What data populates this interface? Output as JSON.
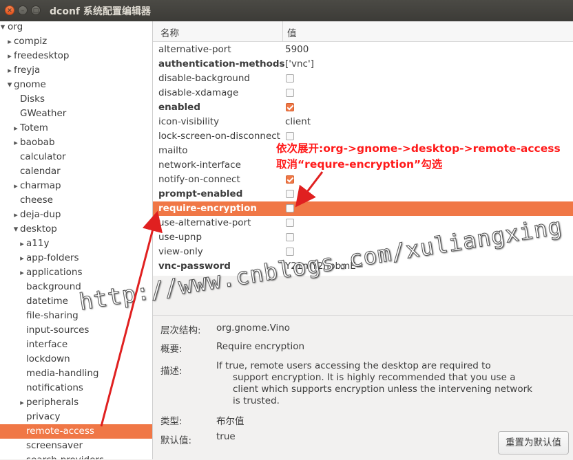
{
  "window": {
    "title": "dconf 系统配置编辑器"
  },
  "tree": [
    {
      "label": "org",
      "level": 0,
      "arrow": "down"
    },
    {
      "label": "compiz",
      "level": 1,
      "arrow": "right"
    },
    {
      "label": "freedesktop",
      "level": 1,
      "arrow": "right"
    },
    {
      "label": "freyja",
      "level": 1,
      "arrow": "right"
    },
    {
      "label": "gnome",
      "level": 1,
      "arrow": "down"
    },
    {
      "label": "Disks",
      "level": 2,
      "arrow": ""
    },
    {
      "label": "GWeather",
      "level": 2,
      "arrow": ""
    },
    {
      "label": "Totem",
      "level": 2,
      "arrow": "right"
    },
    {
      "label": "baobab",
      "level": 2,
      "arrow": "right"
    },
    {
      "label": "calculator",
      "level": 2,
      "arrow": ""
    },
    {
      "label": "calendar",
      "level": 2,
      "arrow": ""
    },
    {
      "label": "charmap",
      "level": 2,
      "arrow": "right"
    },
    {
      "label": "cheese",
      "level": 2,
      "arrow": ""
    },
    {
      "label": "deja-dup",
      "level": 2,
      "arrow": "right"
    },
    {
      "label": "desktop",
      "level": 2,
      "arrow": "down"
    },
    {
      "label": "a11y",
      "level": 3,
      "arrow": "right"
    },
    {
      "label": "app-folders",
      "level": 3,
      "arrow": "right"
    },
    {
      "label": "applications",
      "level": 3,
      "arrow": "right"
    },
    {
      "label": "background",
      "level": 3,
      "arrow": ""
    },
    {
      "label": "datetime",
      "level": 3,
      "arrow": ""
    },
    {
      "label": "file-sharing",
      "level": 3,
      "arrow": ""
    },
    {
      "label": "input-sources",
      "level": 3,
      "arrow": ""
    },
    {
      "label": "interface",
      "level": 3,
      "arrow": ""
    },
    {
      "label": "lockdown",
      "level": 3,
      "arrow": ""
    },
    {
      "label": "media-handling",
      "level": 3,
      "arrow": ""
    },
    {
      "label": "notifications",
      "level": 3,
      "arrow": ""
    },
    {
      "label": "peripherals",
      "level": 3,
      "arrow": "right"
    },
    {
      "label": "privacy",
      "level": 3,
      "arrow": ""
    },
    {
      "label": "remote-access",
      "level": 3,
      "arrow": "",
      "selected": true
    },
    {
      "label": "screensaver",
      "level": 3,
      "arrow": ""
    },
    {
      "label": "search-providers",
      "level": 3,
      "arrow": ""
    }
  ],
  "table": {
    "col_name": "名称",
    "col_value": "值",
    "rows": [
      {
        "key": "alternative-port",
        "type": "text",
        "value": "5900",
        "bold": false
      },
      {
        "key": "authentication-methods",
        "type": "text",
        "value": "['vnc']",
        "bold": true
      },
      {
        "key": "disable-background",
        "type": "check",
        "checked": false,
        "bold": false
      },
      {
        "key": "disable-xdamage",
        "type": "check",
        "checked": false,
        "bold": false
      },
      {
        "key": "enabled",
        "type": "check",
        "checked": true,
        "bold": true
      },
      {
        "key": "icon-visibility",
        "type": "text",
        "value": "client",
        "bold": false
      },
      {
        "key": "lock-screen-on-disconnect",
        "type": "check",
        "checked": false,
        "bold": false
      },
      {
        "key": "mailto",
        "type": "text",
        "value": "",
        "bold": false
      },
      {
        "key": "network-interface",
        "type": "text",
        "value": "",
        "bold": false
      },
      {
        "key": "notify-on-connect",
        "type": "check",
        "checked": true,
        "bold": false
      },
      {
        "key": "prompt-enabled",
        "type": "check",
        "checked": false,
        "bold": true
      },
      {
        "key": "require-encryption",
        "type": "check",
        "checked": false,
        "bold": true,
        "selected": true
      },
      {
        "key": "use-alternative-port",
        "type": "check",
        "checked": false,
        "bold": false
      },
      {
        "key": "use-upnp",
        "type": "check",
        "checked": false,
        "bold": false
      },
      {
        "key": "view-only",
        "type": "check",
        "checked": false,
        "bold": false
      },
      {
        "key": "vnc-password",
        "type": "text",
        "value": "Y21mY2hpbmE=",
        "bold": true
      }
    ]
  },
  "details": {
    "schema_label": "层次结构:",
    "schema_value": "org.gnome.Vino",
    "summary_label": "概要:",
    "summary_value": "Require encryption",
    "desc_label": "描述:",
    "desc_line1": "If true, remote users accessing the desktop are required to",
    "desc_lines_rest": [
      "support encryption. It is highly recommended that you use a",
      "client which supports encryption unless the intervening network",
      "is trusted."
    ],
    "type_label": "类型:",
    "type_value": "布尔值",
    "default_label": "默认值:",
    "default_value": "true",
    "reset_button": "重置为默认值"
  },
  "annotation": {
    "line1": "依次展开:org->gnome->desktop->remote-access",
    "line2": "取消“requre-encryption”勾选",
    "watermark": "http://www.cnblogs.com/xuliangxing",
    "color": "#ff1a1a"
  },
  "icons": {
    "close": "close-icon",
    "minimize": "minimize-icon",
    "maximize": "maximize-icon"
  }
}
